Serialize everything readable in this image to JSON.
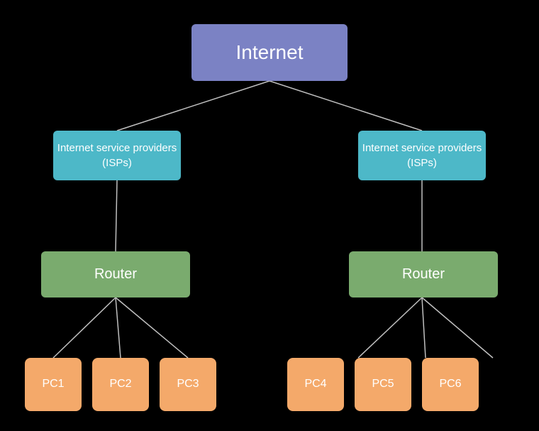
{
  "nodes": {
    "internet": {
      "label": "Internet"
    },
    "isp_left": {
      "label": "Internet service providers (ISPs)"
    },
    "isp_right": {
      "label": "Internet service providers (ISPs)"
    },
    "router_left": {
      "label": "Router"
    },
    "router_right": {
      "label": "Router"
    },
    "pc1": {
      "label": "PC1"
    },
    "pc2": {
      "label": "PC2"
    },
    "pc3": {
      "label": "PC3"
    },
    "pc4": {
      "label": "PC4"
    },
    "pc5": {
      "label": "PC5"
    },
    "pc6": {
      "label": "PC6"
    }
  },
  "colors": {
    "internet": "#7b82c4",
    "isp": "#4db8c8",
    "router": "#7aab6e",
    "pc": "#f4a96a",
    "line": "#c0c0c0",
    "background": "#000000"
  }
}
